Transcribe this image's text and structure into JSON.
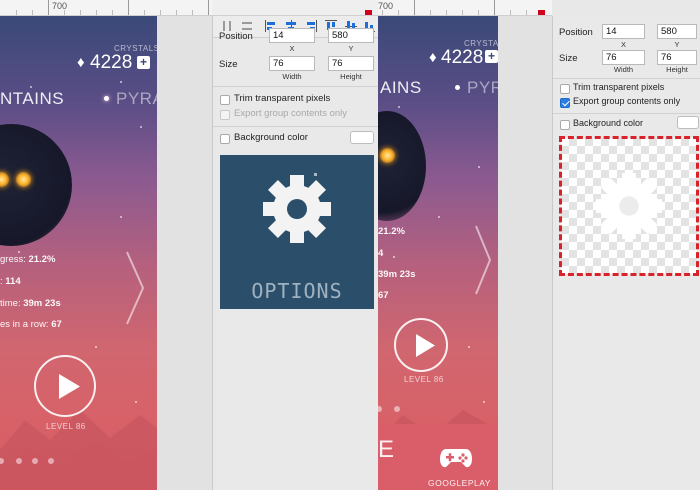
{
  "ruler": {
    "left_label": "700",
    "right_label": "700"
  },
  "game": {
    "crystals_label": "CRYSTALS",
    "crystals_value": "4228",
    "plus_label": "+",
    "world_current": "NTAINS",
    "world_next": "PYRA",
    "world_current_right": "AINS",
    "world_next_right": "PYRA",
    "stats": [
      {
        "label": "gress:",
        "value": "21.2%"
      },
      {
        "label": ":",
        "value": "114"
      },
      {
        "label": "time:",
        "value": "39m 23s"
      },
      {
        "label": "es in a row:",
        "value": "67"
      }
    ],
    "stats_right": [
      {
        "value": "21.2%"
      },
      {
        "value": "4"
      },
      {
        "value": "39m 23s"
      },
      {
        "value": "67"
      }
    ],
    "level_label": "LEVEL 86",
    "googleplay_label": "GOOGLEPLAY",
    "menu_glyph": "E"
  },
  "inspector_left": {
    "position_label": "Position",
    "x_value": "14",
    "y_value": "580",
    "x_label": "X",
    "y_label": "Y",
    "size_label": "Size",
    "width_value": "76",
    "height_value": "76",
    "width_label": "Width",
    "height_label": "Height",
    "trim_label": "Trim transparent pixels",
    "trim_checked": false,
    "export_group_label": "Export group contents only",
    "export_group_checked": false,
    "bg_color_label": "Background color",
    "bg_color_checked": false,
    "preview_caption": "OPTIONS"
  },
  "inspector_right": {
    "position_label": "Position",
    "x_value": "14",
    "y_value": "580",
    "x_label": "X",
    "y_label": "Y",
    "size_label": "Size",
    "width_value": "76",
    "height_value": "76",
    "width_label": "Width",
    "height_label": "Height",
    "trim_label": "Trim transparent pixels",
    "trim_checked": false,
    "export_group_label": "Export group contents only",
    "export_group_checked": true,
    "bg_color_label": "Background color",
    "bg_color_checked": false
  },
  "colors": {
    "accent": "#1e6fd9",
    "highlight_dashed": "#d8232a",
    "preview_bg": "#2b4f6a"
  }
}
